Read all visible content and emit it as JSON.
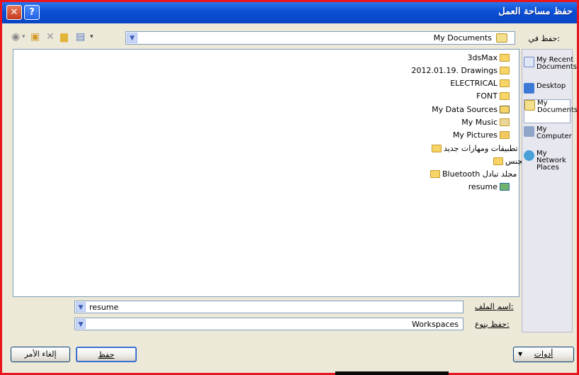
{
  "window": {
    "title": "حفظ مساحة العمل"
  },
  "toolbar": {
    "lookin_label": "حفظ في:",
    "lookin_value": "My Documents"
  },
  "files": [
    {
      "name": "3dsMax",
      "type": "folder"
    },
    {
      "name": "2012.01.19. Drawings",
      "type": "folder"
    },
    {
      "name": "ELECTRICAL",
      "type": "folder"
    },
    {
      "name": "FONT",
      "type": "folder"
    },
    {
      "name": "My Data Sources",
      "type": "special-folder"
    },
    {
      "name": "My Music",
      "type": "music-folder"
    },
    {
      "name": "My Pictures",
      "type": "pictures-folder"
    },
    {
      "name": "تطبيقات ومهارات جديد",
      "type": "folder"
    },
    {
      "name": "سيجنس",
      "type": "folder"
    },
    {
      "name": "Bluetooth مجلد تبادل",
      "type": "folder"
    },
    {
      "name": "resume",
      "type": "workspace-file"
    }
  ],
  "places": [
    {
      "label": "My Recent Documents"
    },
    {
      "label": "Desktop"
    },
    {
      "label": "My Documents"
    },
    {
      "label": "My Computer"
    },
    {
      "label": "My Network Places"
    }
  ],
  "filename": {
    "label": "اسم الملف:",
    "value": "resume"
  },
  "filetype": {
    "label": "حفظ بنوع:",
    "value": "Workspaces"
  },
  "buttons": {
    "tools": "أدوات",
    "save": "حفظ",
    "cancel": "إلغاء الأمر"
  }
}
